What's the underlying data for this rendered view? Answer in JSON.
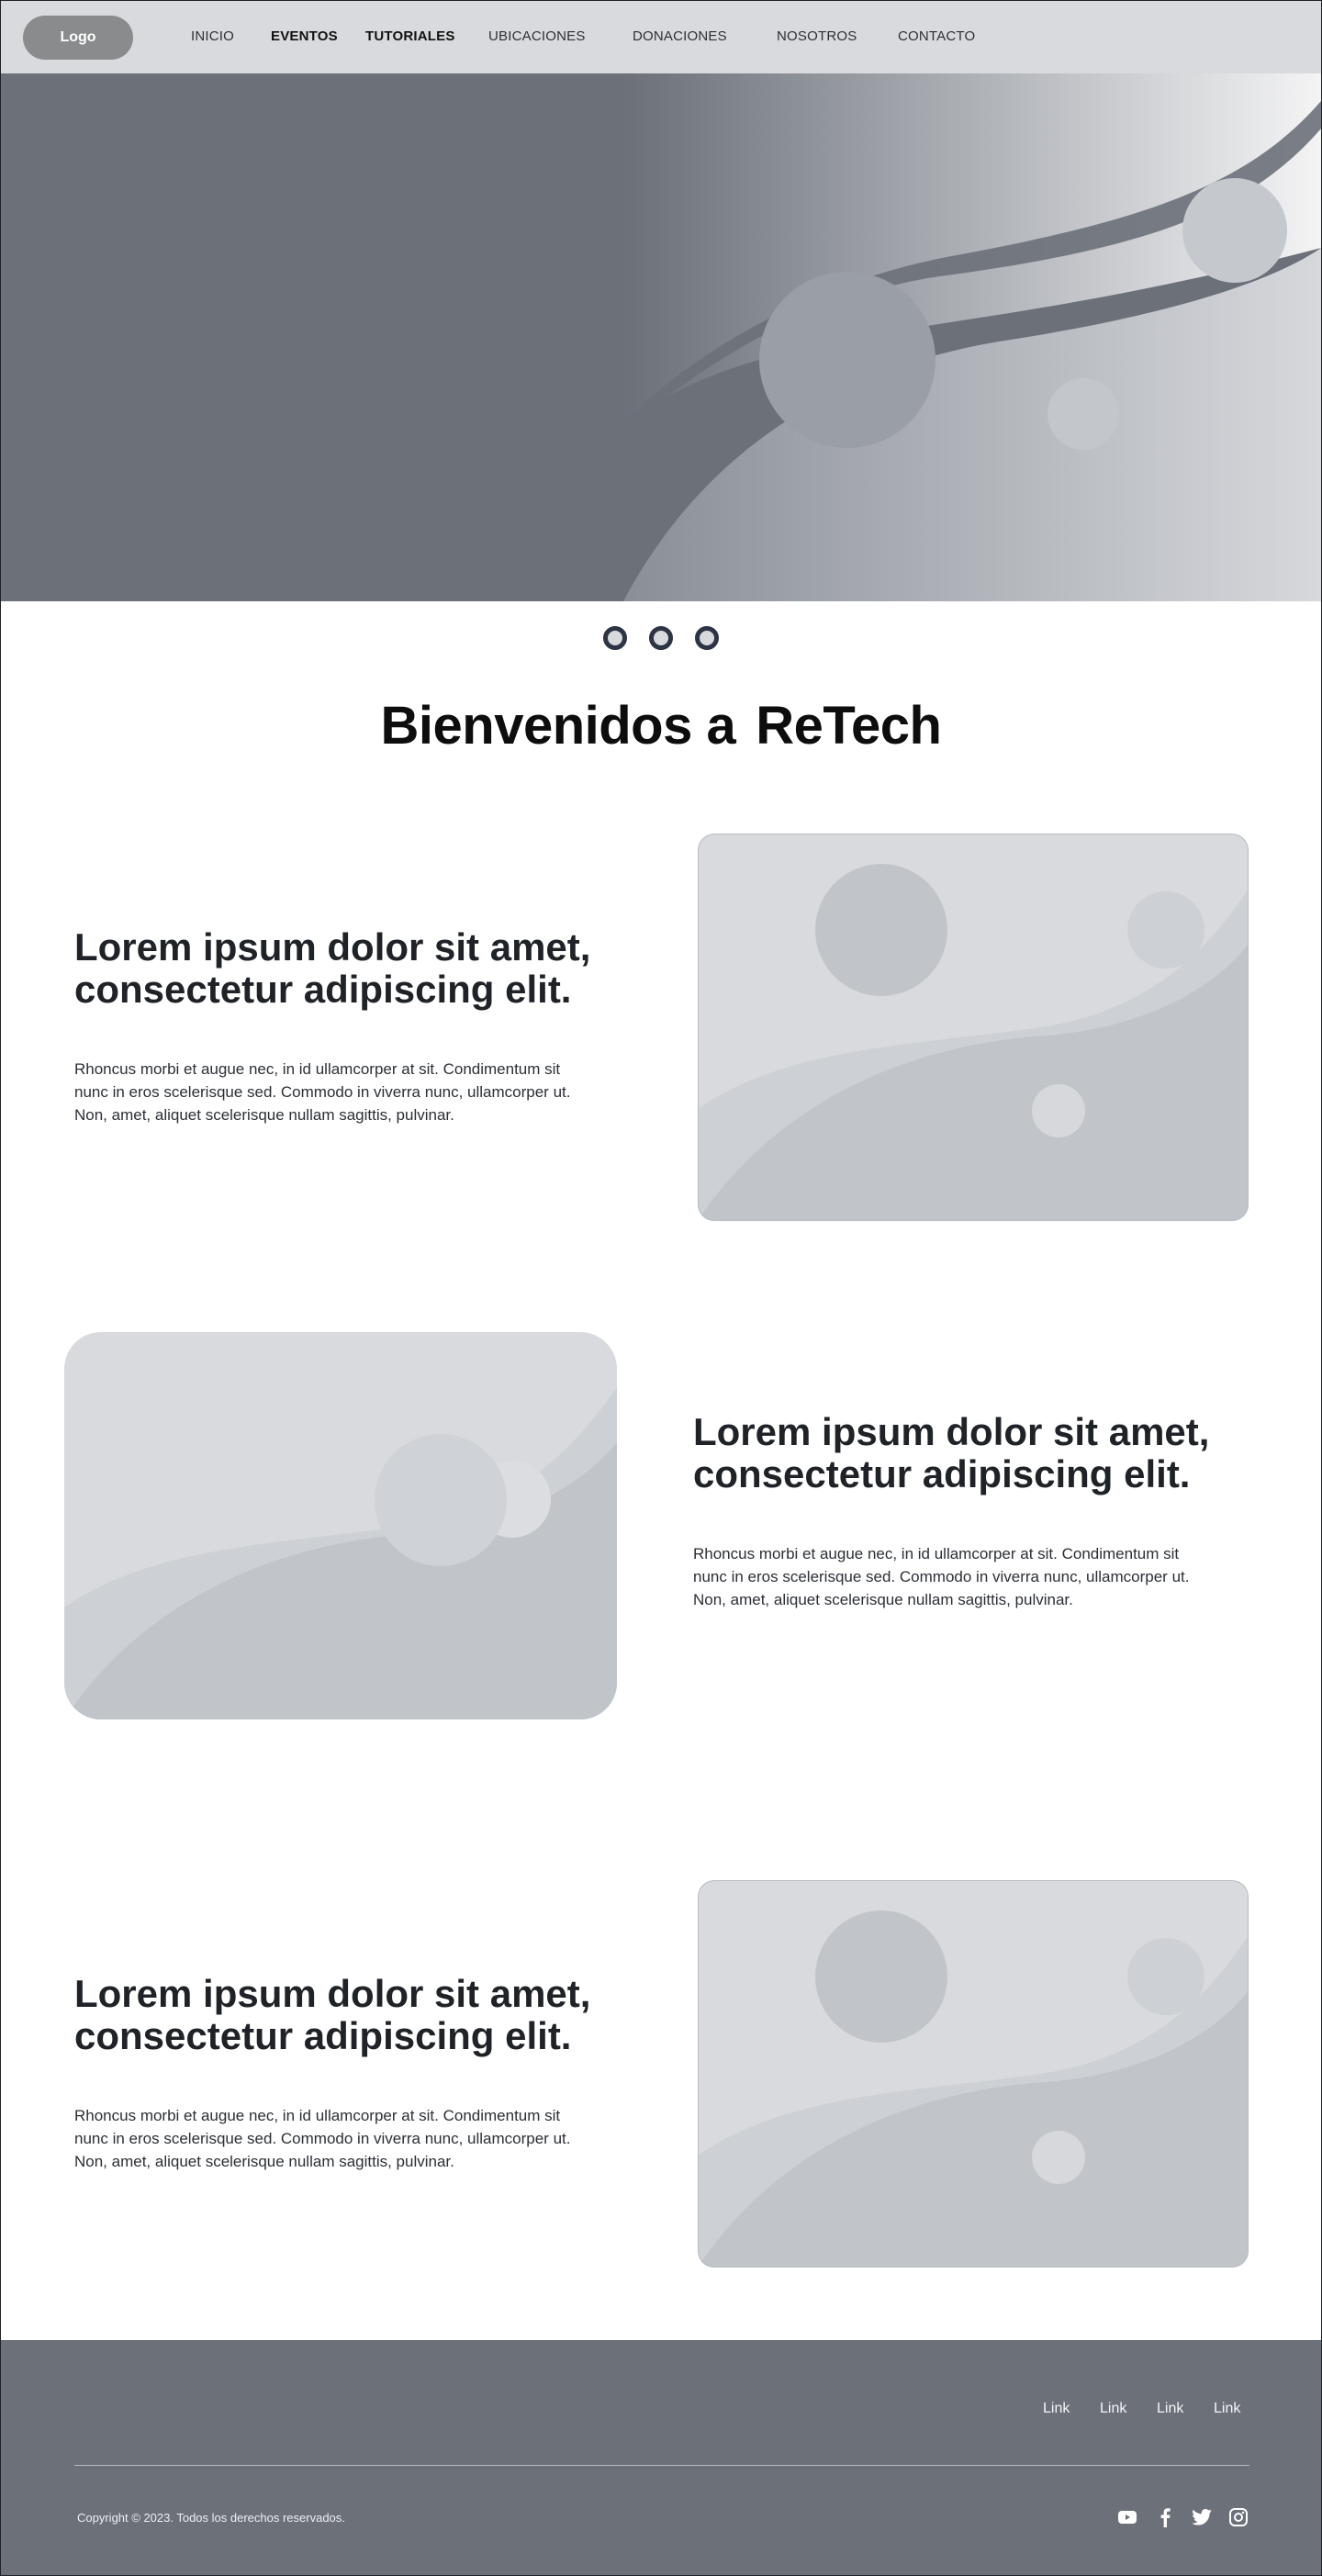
{
  "nav": {
    "logo": "Logo",
    "items": [
      "INICIO",
      "EVENTOS",
      "TUTORIALES",
      "UBICACIONES",
      "DONACIONES",
      "NOSOTROS",
      "CONTACTO"
    ]
  },
  "colors": {
    "nav_bg": "#d9dadd",
    "hero_bg": "#6b7079",
    "footer_bg": "#6b7079",
    "accent_dot": "#2d3545",
    "placeholder": "#c1c5c9"
  },
  "welcome": {
    "part1": "Bienvenidos a",
    "part2": "ReTech"
  },
  "features": [
    {
      "heading_line1": "Lorem ipsum dolor sit amet,",
      "heading_line2": "consectetur adipiscing elit.",
      "text_line1": "Rhoncus morbi et augue nec, in id ullamcorper at sit. Condimentum sit",
      "text_line2": "nunc in eros scelerisque sed. Commodo in viverra nunc, ullamcorper ut.",
      "text_line3": "Non, amet, aliquet scelerisque nullam sagittis, pulvinar."
    },
    {
      "heading_line1": "Lorem ipsum dolor sit amet,",
      "heading_line2": "consectetur adipiscing elit.",
      "text_line1": "Rhoncus morbi et augue nec, in id ullamcorper at sit. Condimentum sit",
      "text_line2": "nunc in eros scelerisque sed. Commodo in viverra nunc, ullamcorper ut.",
      "text_line3": "Non, amet, aliquet scelerisque nullam sagittis, pulvinar."
    },
    {
      "heading_line1": "Lorem ipsum dolor sit amet,",
      "heading_line2": "consectetur adipiscing elit.",
      "text_line1": "Rhoncus morbi et augue nec, in id ullamcorper at sit. Condimentum sit",
      "text_line2": "nunc in eros scelerisque sed. Commodo in viverra nunc, ullamcorper ut.",
      "text_line3": "Non, amet, aliquet scelerisque nullam sagittis, pulvinar."
    }
  ],
  "footer": {
    "links": [
      "Link",
      "Link",
      "Link",
      "Link"
    ],
    "copyright": "Copyright © 2023. Todos los derechos reservados.",
    "social_icons": [
      "youtube-icon",
      "facebook-icon",
      "twitter-icon",
      "instagram-icon"
    ]
  }
}
